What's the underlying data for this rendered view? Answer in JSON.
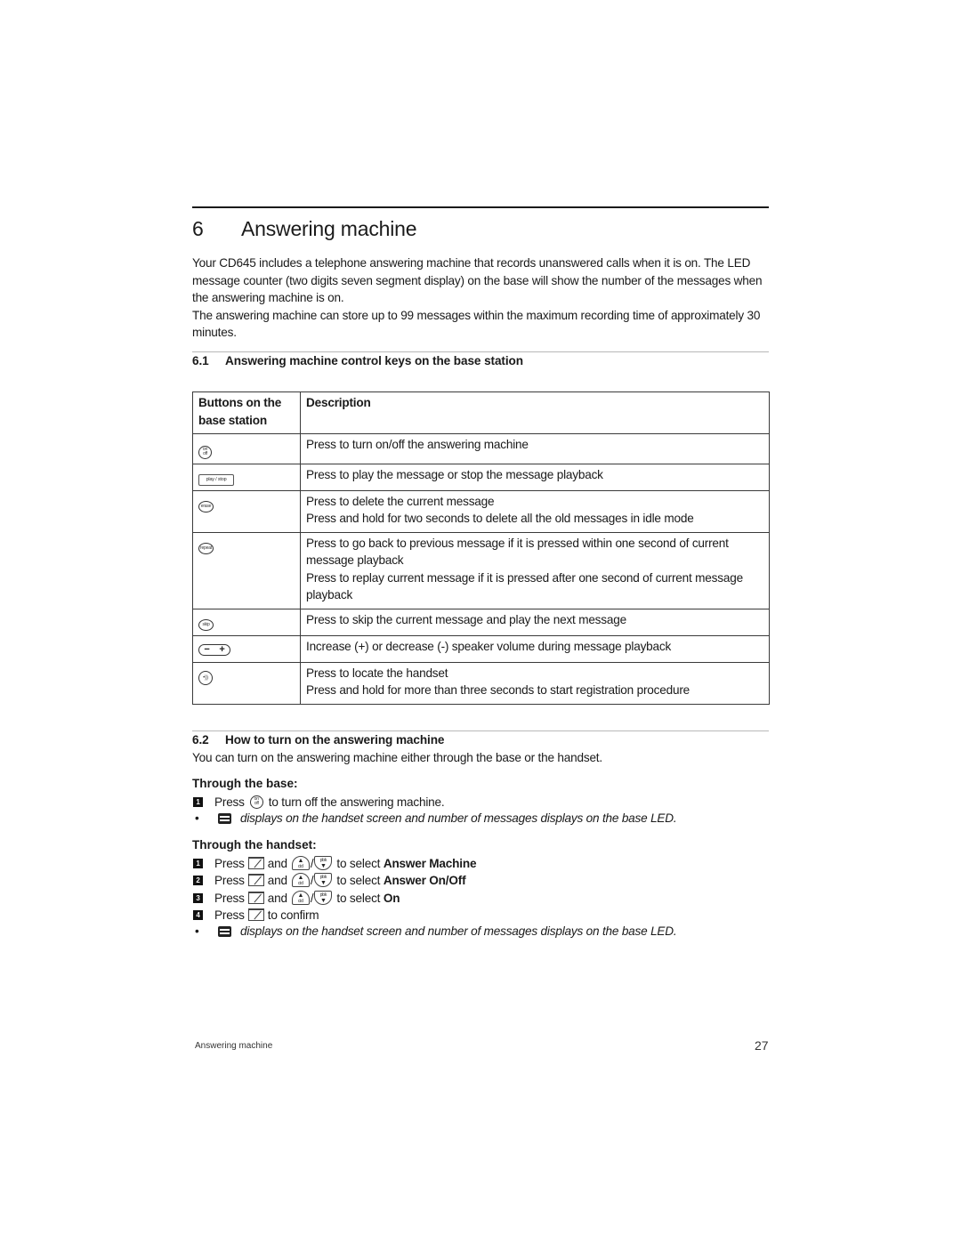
{
  "chapter": {
    "number": "6",
    "title": "Answering machine"
  },
  "intro": {
    "paragraph1": "Your CD645 includes a telephone answering machine that records unanswered calls when it is on. The LED message counter (two digits seven segment display) on the base will show the number of the messages when the answering machine is on.",
    "paragraph2": "The answering machine can store up to 99 messages within the maximum recording time of approximately 30 minutes."
  },
  "section1": {
    "number": "6.1",
    "title": "Answering machine control keys on the base station",
    "table": {
      "headers": [
        "Buttons on the base station",
        "Description"
      ],
      "rows": [
        {
          "icon": "on-off-button-icon",
          "icon_text": [
            "on",
            "off"
          ],
          "description": [
            "Press to turn on/off the answering machine"
          ]
        },
        {
          "icon": "play-stop-button-icon",
          "icon_text": [
            "play / stop"
          ],
          "description": [
            "Press to play the message or stop the message playback"
          ]
        },
        {
          "icon": "erase-button-icon",
          "icon_text": [
            "erase"
          ],
          "description": [
            "Press to delete the current message",
            "Press and hold for two seconds to delete all the old messages in idle mode"
          ]
        },
        {
          "icon": "repeat-button-icon",
          "icon_text": [
            "repeat"
          ],
          "description": [
            "Press to go back to previous message if it is pressed within one second of current message playback",
            "Press to replay current message if it is pressed after one second of current message playback"
          ]
        },
        {
          "icon": "skip-button-icon",
          "icon_text": [
            "skip"
          ],
          "description": [
            "Press to skip the current message and play the next message"
          ]
        },
        {
          "icon": "volume-button-icon",
          "icon_text": [
            "−",
            "+"
          ],
          "description": [
            "Increase (+) or decrease (-) speaker volume during message playback"
          ]
        },
        {
          "icon": "paging-button-icon",
          "icon_text": [
            "•))"
          ],
          "description": [
            "Press to locate the handset",
            "Press and hold for more than three seconds to start registration procedure"
          ]
        }
      ]
    }
  },
  "section2": {
    "number": "6.2",
    "title": "How to turn on the answering machine",
    "intro": "You can turn on the answering machine either through the base or the handset.",
    "through_base": {
      "title": "Through the base:",
      "steps": [
        {
          "num": "1",
          "pre": "Press",
          "post": "to turn off the answering machine."
        }
      ],
      "note": "displays on the handset screen and  number of messages displays on the base LED."
    },
    "through_handset": {
      "title": "Through the handset:",
      "steps": [
        {
          "num": "1",
          "pre": "Press",
          "mid": "and",
          "post": "to select",
          "target": "Answer Machine"
        },
        {
          "num": "2",
          "pre": "Press",
          "mid": "and",
          "post": "to select",
          "target": "Answer On/Off"
        },
        {
          "num": "3",
          "pre": "Press",
          "mid": "and",
          "post": "to select",
          "target": "On"
        },
        {
          "num": "4",
          "pre": "Press",
          "post": "to confirm"
        }
      ],
      "note": "displays on the handset screen and number of messages displays on the base LED.",
      "nav_up_label": "cid",
      "nav_down_label": "pbk",
      "slash": "/"
    }
  },
  "bullet": "•",
  "footer": {
    "section_name": "Answering machine",
    "page_number": "27"
  }
}
